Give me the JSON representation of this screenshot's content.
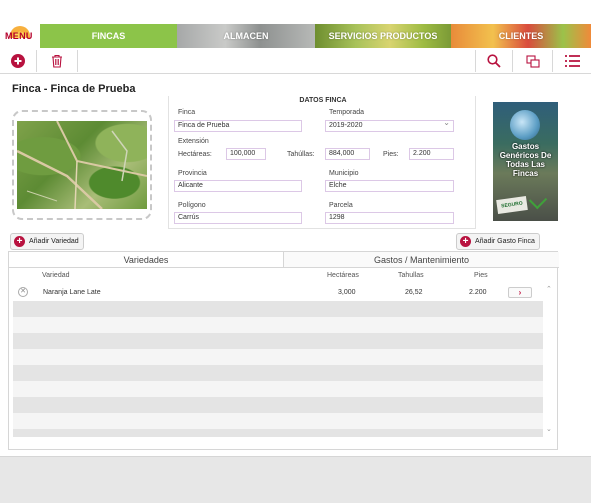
{
  "nav": {
    "menu": "MENU",
    "tabs": [
      "FINCAS",
      "ALMACEN",
      "SERVICIOS PRODUCTOS",
      "CLIENTES"
    ],
    "active": "FINCAS"
  },
  "page": {
    "title": "Finca - Finca de Prueba"
  },
  "datos": {
    "title": "DATOS FINCA",
    "finca_label": "Finca",
    "finca_value": "Finca de Prueba",
    "temporada_label": "Temporada",
    "temporada_value": "2019-2020",
    "extension_label": "Extensión",
    "hectareas_label": "Hectáreas:",
    "hectareas_value": "100,000",
    "tahullas_label": "Tahúllas:",
    "tahullas_value": "884,000",
    "pies_label": "Pies:",
    "pies_value": "2.200",
    "provincia_label": "Provincia",
    "provincia_value": "Alicante",
    "municipio_label": "Municipio",
    "municipio_value": "Elche",
    "poligono_label": "Polígono",
    "poligono_value": "Carrús",
    "parcela_label": "Parcela",
    "parcela_value": "1298"
  },
  "gastos_card": {
    "text": "Gastos Genéricos De Todas Las Fincas",
    "sign": "SEGURO"
  },
  "buttons": {
    "add_variedad": "Añadir Variedad",
    "add_gasto": "Añadir Gasto Finca"
  },
  "tabs": {
    "variedades": "Variedades",
    "gastos": "Gastos / Mantenimiento"
  },
  "table": {
    "headers": {
      "variedad": "Variedad",
      "hectareas": "Hectáreas",
      "tahullas": "Tahullas",
      "pies": "Pies"
    },
    "rows": [
      {
        "variedad": "Naranja Lane Late",
        "hectareas": "3,000",
        "tahullas": "26,52",
        "pies": "2.200"
      }
    ]
  },
  "colors": {
    "accent": "#b8123f",
    "fincas_tab": "#8cc449"
  }
}
